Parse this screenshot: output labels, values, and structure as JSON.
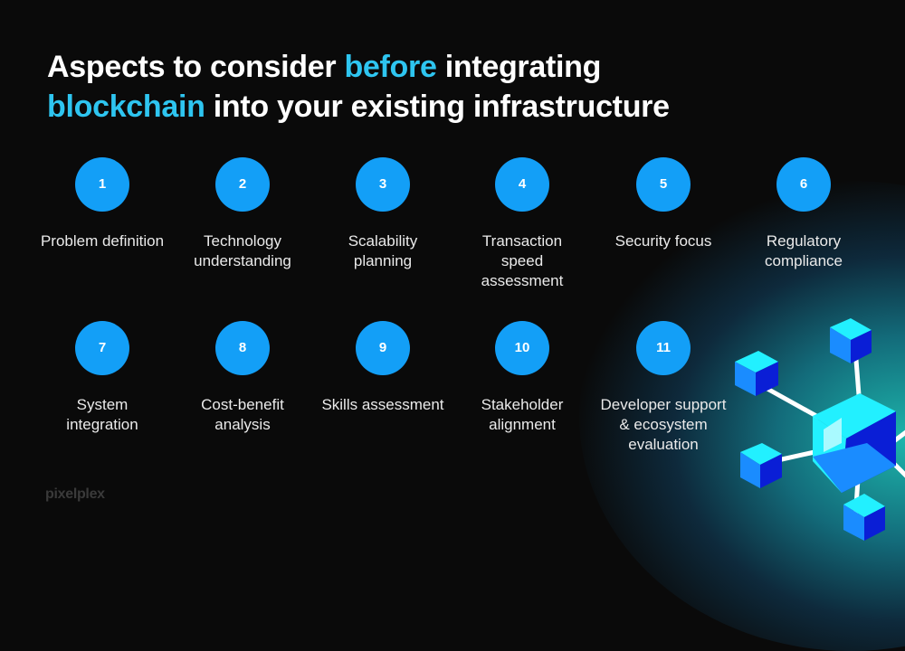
{
  "title": {
    "part1": "Aspects to consider ",
    "accent1": "before",
    "part2": " integrating",
    "accent2": "blockchain",
    "part3": " into your existing infrastructure"
  },
  "accent_color": "#2ec5f0",
  "circle_color": "#139ff7",
  "items": [
    {
      "number": "1",
      "label": "Problem definition"
    },
    {
      "number": "2",
      "label": "Technology\nunderstanding"
    },
    {
      "number": "3",
      "label": "Scalability\nplanning"
    },
    {
      "number": "4",
      "label": "Transaction\nspeed\nassessment"
    },
    {
      "number": "5",
      "label": "Security focus"
    },
    {
      "number": "6",
      "label": "Regulatory\ncompliance"
    },
    {
      "number": "7",
      "label": "System\nintegration"
    },
    {
      "number": "8",
      "label": "Cost-benefit\nanalysis"
    },
    {
      "number": "9",
      "label": "Skills assessment"
    },
    {
      "number": "10",
      "label": "Stakeholder\nalignment"
    },
    {
      "number": "11",
      "label": "Developer support\n& ecosystem\nevaluation"
    }
  ],
  "logo": "pixelplex",
  "illustration": "blockchain-cubes-icon"
}
